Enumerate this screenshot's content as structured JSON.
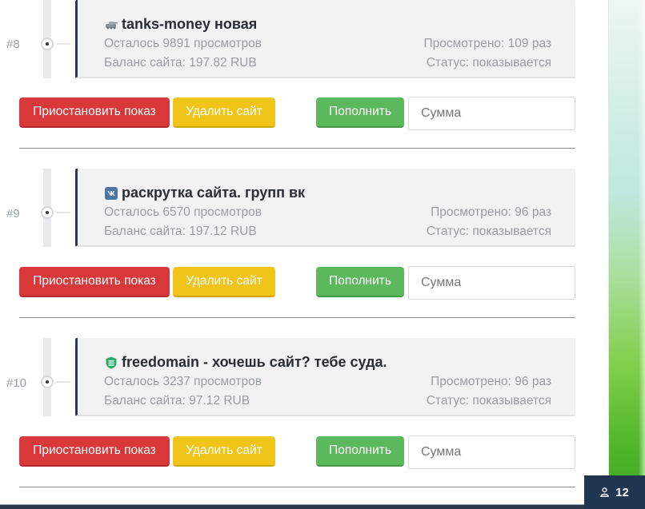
{
  "entries": [
    {
      "number": "#8",
      "title": "tanks-money новая",
      "icon": "tanks-icon",
      "remaining": "Осталось 9891 просмотров",
      "viewed": "Просмотрено: 109 раз",
      "balance": "Баланс сайта: 197.82 RUB",
      "status": "Статус: показывается"
    },
    {
      "number": "#9",
      "title": "раскрутка сайта. групп вк",
      "icon": "vk-icon",
      "remaining": "Осталось 6570 просмотров",
      "viewed": "Просмотрено: 96 раз",
      "balance": "Баланс сайта: 197.12 RUB",
      "status": "Статус: показывается"
    },
    {
      "number": "#10",
      "title": "freedomain - хочешь сайт? тебе суда.",
      "icon": "freedomain-icon",
      "remaining": "Осталось 3237 просмотров",
      "viewed": "Просмотрено: 96 раз",
      "balance": "Баланс сайта: 97.12 RUB",
      "status": "Статус: показывается"
    }
  ],
  "buttons": {
    "pause": "Приостановить показ",
    "delete": "Удалить сайт",
    "fund": "Пополнить"
  },
  "amount_placeholder": "Сумма",
  "online_count": "12",
  "colors": {
    "pause": "#d9383a",
    "delete": "#f0c419",
    "fund": "#5cb85c",
    "card_border": "#2c3a4a",
    "badge": "#1f3550"
  }
}
